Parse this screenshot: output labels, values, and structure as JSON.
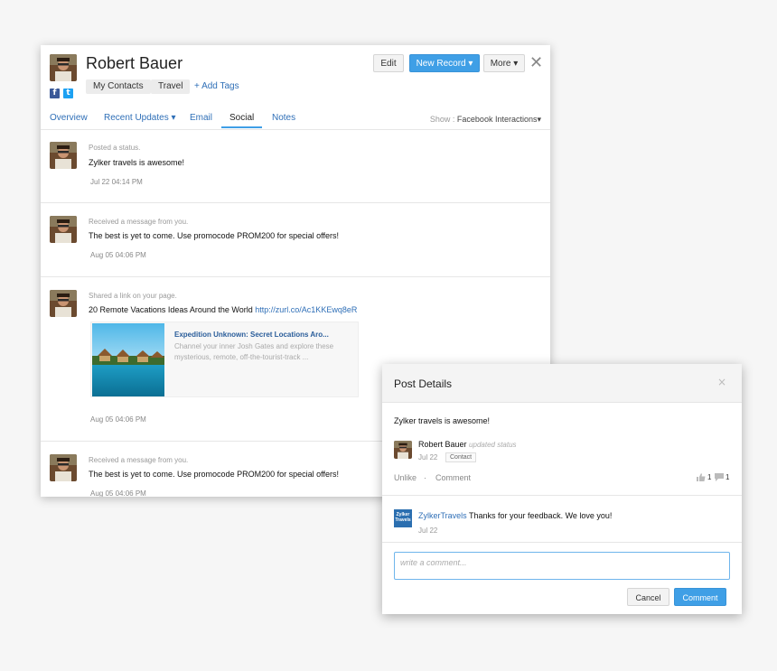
{
  "record": {
    "name": "Robert Bauer",
    "tags": [
      "My Contacts",
      "Travel"
    ],
    "add_tags": "+ Add Tags",
    "social_icons": [
      "facebook-icon",
      "twitter-icon"
    ],
    "buttons": {
      "edit": "Edit",
      "new_record": "New Record ▾",
      "more": "More ▾",
      "close": "✕"
    }
  },
  "tabs": [
    "Overview",
    "Recent Updates ▾",
    "Email",
    "Social",
    "Notes"
  ],
  "active_tab": "Social",
  "show": {
    "label": "Show : ",
    "value": "Facebook Interactions▾"
  },
  "feed": [
    {
      "meta": "Posted a status.",
      "message": "Zylker travels is awesome!",
      "time": "Jul 22 04:14 PM"
    },
    {
      "meta": "Received a message from you.",
      "message": "The best is yet to come. Use promocode PROM200 for special offers!",
      "time": "Aug 05 04:06 PM"
    },
    {
      "meta": "Shared a link on your page.",
      "message": "20 Remote Vacations Ideas Around the World ",
      "link": "http://zurl.co/Ac1KKEwq8eR",
      "card": {
        "title": "Expedition Unknown: Secret Locations Aro...",
        "description": "Channel your inner Josh Gates and explore these mysterious, remote, off-the-tourist-track ..."
      },
      "time": "Aug 05 04:06 PM"
    },
    {
      "meta": "Received a message from you.",
      "message": "The best is yet to come. Use promocode PROM200 for special offers!",
      "time": "Aug 05 04:06 PM"
    }
  ],
  "modal": {
    "title": "Post Details",
    "close": "×",
    "post_text": "Zylker travels is awesome!",
    "author": "Robert Bauer",
    "action": "updated status",
    "date": "Jul 22",
    "badge": "Contact",
    "unlike": "Unlike",
    "separator": "·",
    "comment_link": "Comment",
    "likes": "1",
    "comments_count": "1",
    "reply": {
      "logo": "Zylker Travels",
      "author": "ZylkerTravels",
      "text": " Thanks for your feedback. We love you!",
      "date": "Jul 22"
    },
    "comment_placeholder": "write a comment...",
    "cancel": "Cancel",
    "submit": "Comment"
  },
  "colors": {
    "accent": "#3f9fe6",
    "link": "#2f6fb7",
    "facebook": "#3b5998",
    "twitter": "#1da1f2"
  }
}
